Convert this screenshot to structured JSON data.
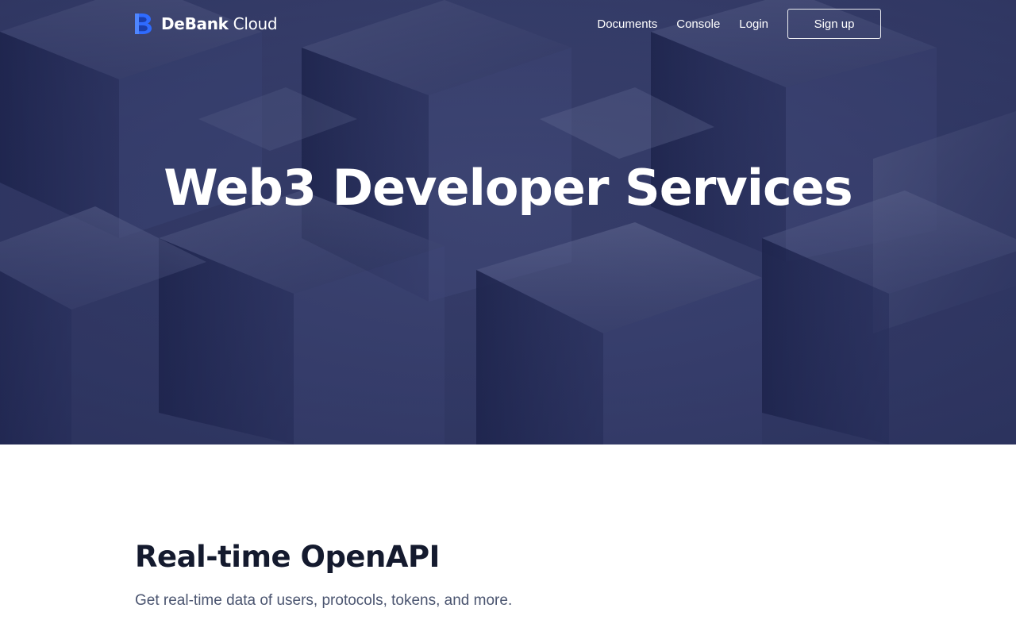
{
  "header": {
    "logo_bold": "DeBank",
    "logo_light": "Cloud",
    "nav": [
      "Documents",
      "Console",
      "Login"
    ],
    "signup_label": "Sign up"
  },
  "hero": {
    "title": "Web3 Developer Services"
  },
  "openapi": {
    "title": "Real-time OpenAPI",
    "subtitle": "Get real-time data of users, protocols, tokens, and more."
  },
  "colors": {
    "brand_blue": "#2f6bff",
    "hero_bg": "#3c4470",
    "heading_dark": "#141a2e",
    "subtext": "#4b5570"
  },
  "icons": {
    "logo": "debank-logo-icon"
  }
}
